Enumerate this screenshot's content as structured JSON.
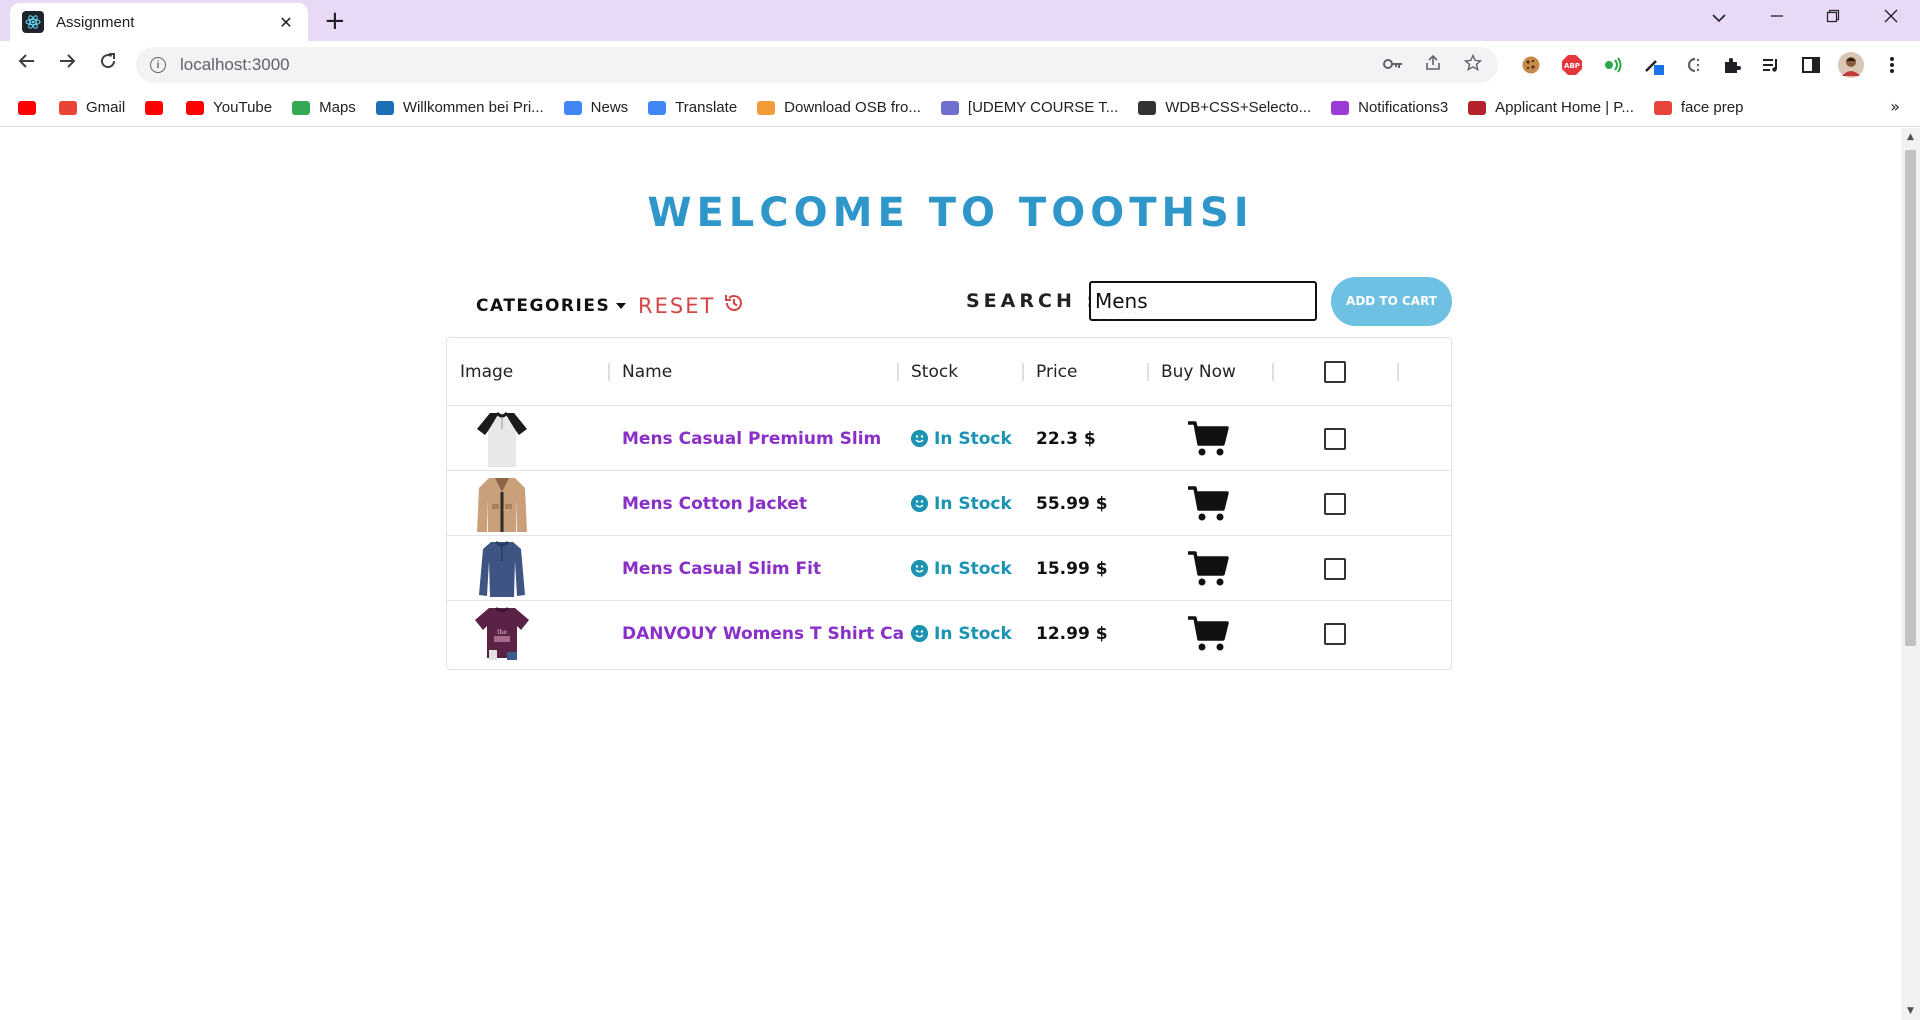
{
  "browser": {
    "tab_title": "Assignment",
    "tab_close": "✕",
    "new_tab": "+",
    "url": "localhost:3000",
    "bookmarks": [
      {
        "label": "",
        "color": "#ff0000"
      },
      {
        "label": "Gmail",
        "color": "#ea4335"
      },
      {
        "label": "",
        "color": "#ff0000"
      },
      {
        "label": "YouTube",
        "color": "#ff0000"
      },
      {
        "label": "Maps",
        "color": "#34a853"
      },
      {
        "label": "Willkommen bei Pri...",
        "color": "#1a6fb5"
      },
      {
        "label": "News",
        "color": "#4285f4"
      },
      {
        "label": "Translate",
        "color": "#4285f4"
      },
      {
        "label": "Download OSB fro...",
        "color": "#f29b38"
      },
      {
        "label": "[UDEMY COURSE T...",
        "color": "#6f6fd0"
      },
      {
        "label": "WDB+CSS+Selecto...",
        "color": "#333333"
      },
      {
        "label": "Notifications3",
        "color": "#9b3cd8"
      },
      {
        "label": "Applicant Home | P...",
        "color": "#b3222a"
      },
      {
        "label": "face prep",
        "color": "#e8463c"
      }
    ],
    "bookmarks_more": "»"
  },
  "page": {
    "title": "WELCOME TO TOOTHSI",
    "categories_label": "CATEGORIES",
    "reset_label": "RESET",
    "search_label": "SEARCH :",
    "search_value": "Mens",
    "add_to_cart_label": "ADD TO CART"
  },
  "table": {
    "columns": [
      "Image",
      "Name",
      "Stock",
      "Price",
      "Buy Now"
    ],
    "rows": [
      {
        "name": "Mens Casual Premium Slim",
        "stock": "In Stock",
        "price": "22.3 $",
        "image": "raglan-tee"
      },
      {
        "name": "Mens Cotton Jacket",
        "stock": "In Stock",
        "price": "55.99 $",
        "image": "cotton-jacket"
      },
      {
        "name": "Mens Casual Slim Fit",
        "stock": "In Stock",
        "price": "15.99 $",
        "image": "slim-fit-shirt"
      },
      {
        "name": "DANVOUY Womens T Shirt Ca",
        "stock": "In Stock",
        "price": "12.99 $",
        "image": "purple-tshirt"
      }
    ]
  },
  "colors": {
    "title": "#2e96c9",
    "reset": "#d64545",
    "product_name": "#8a2fc7",
    "stock": "#1b94b3",
    "add_to_cart_bg": "#6ec1e3",
    "tabbar": "#e8d9f7"
  }
}
